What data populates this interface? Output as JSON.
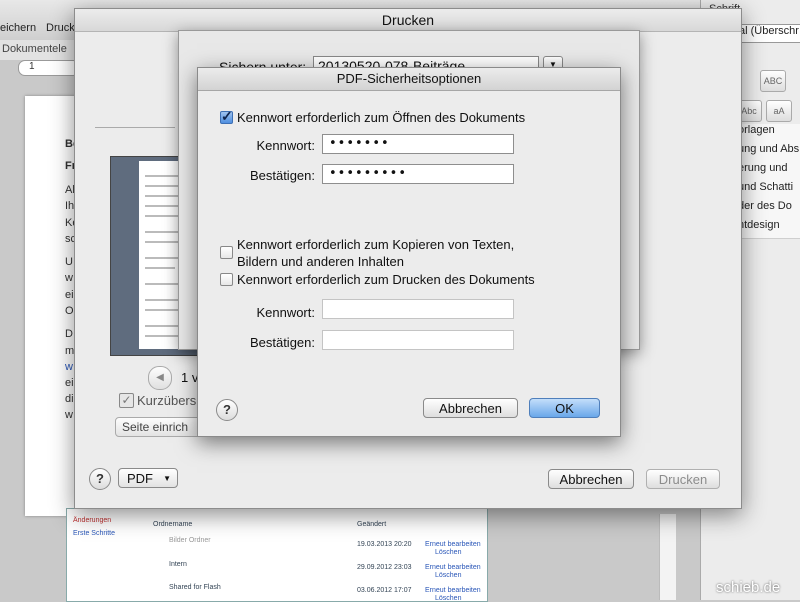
{
  "background": {
    "toolbar_labels": [
      "eichern",
      "Druck"
    ],
    "tab_label": "Dokumentele",
    "ruler_value": "1",
    "doc_fragments": [
      "Be",
      "Fr",
      "Al",
      "Ih",
      "Ke",
      "sc",
      "U",
      "w",
      "ei",
      "O",
      "D",
      "m",
      "w",
      "ei",
      "di",
      "w"
    ],
    "right_panel": {
      "font_label": "Schrift",
      "style_field": "al (Überschr",
      "style_items": [
        "orlagen",
        "ung und Abs",
        "erung und",
        "und Schatti",
        "der des Do",
        "ntdesign"
      ]
    },
    "lower_table": {
      "sidebar": [
        "Änderungen",
        "Erste Schritte"
      ],
      "headers": [
        "Ordnername",
        "Geändert"
      ],
      "rows": [
        {
          "name": "Bilder Ordner",
          "date": "19.03.2013 20:20",
          "actions": [
            "Erneut bearbeiten",
            "Löschen"
          ]
        },
        {
          "name": "Intern",
          "date": "29.09.2012 23:03",
          "actions": [
            "Erneut bearbeiten",
            "Löschen"
          ]
        },
        {
          "name": "Shared for Flash",
          "date": "03.06.2012 17:07",
          "actions": [
            "Erneut bearbeiten",
            "Löschen"
          ]
        }
      ]
    }
  },
  "print_dialog": {
    "title": "Drucken",
    "page_count": "1 v",
    "thumbnail_label": "Kurzübersic",
    "page_setup_label": "Seite einrich",
    "pdf_label": "PDF",
    "cancel_label": "Abbrechen",
    "print_label": "Drucken"
  },
  "save_sheet": {
    "save_as_label": "Sichern unter:",
    "filename": "20130520-078-Beiträge"
  },
  "security_dialog": {
    "title": "PDF-Sicherheitsoptionen",
    "open_checkbox": {
      "label": "Kennwort erforderlich zum Öffnen des Dokuments",
      "checked": true
    },
    "open_password_label": "Kennwort:",
    "open_password_value": "•••••••",
    "open_confirm_label": "Bestätigen:",
    "open_confirm_value": "•••••••••",
    "copy_checkbox": {
      "label_line1": "Kennwort erforderlich zum Kopieren von Texten,",
      "label_line2": "Bildern und anderen Inhalten",
      "checked": false
    },
    "print_checkbox": {
      "label": "Kennwort erforderlich zum Drucken des Dokuments",
      "checked": false
    },
    "perm_password_label": "Kennwort:",
    "perm_password_value": "",
    "perm_confirm_label": "Bestätigen:",
    "perm_confirm_value": "",
    "cancel_label": "Abbrechen",
    "ok_label": "OK"
  },
  "watermark": "schieb.de",
  "colors": {
    "accent": "#4f8fe0",
    "ok_button": "#6aa7ea"
  }
}
